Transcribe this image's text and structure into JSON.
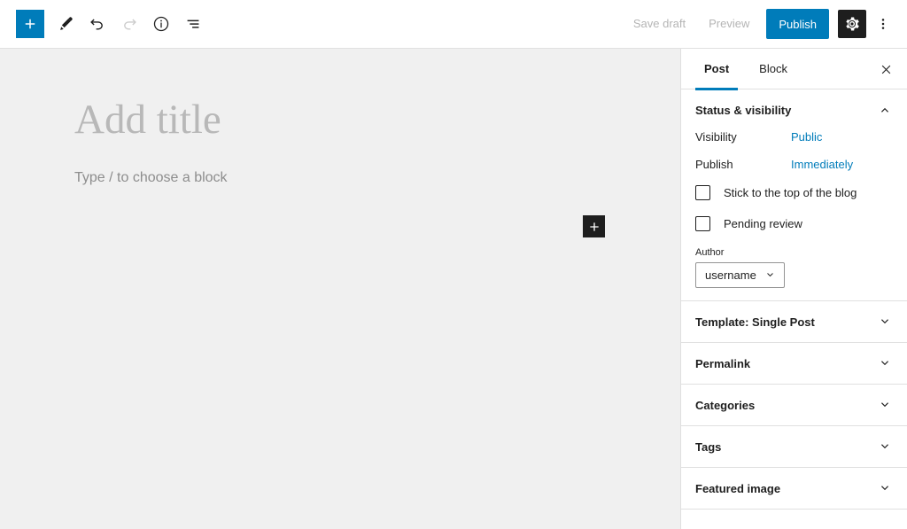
{
  "toolbar": {
    "inserter_label": "+",
    "icons": [
      {
        "name": "block-inserter-icon",
        "label": "Add block"
      },
      {
        "name": "pencil-icon",
        "label": "Tools"
      },
      {
        "name": "undo-icon",
        "label": "Undo"
      },
      {
        "name": "redo-icon",
        "label": "Redo"
      },
      {
        "name": "info-icon",
        "label": "Details"
      },
      {
        "name": "list-view-icon",
        "label": "List view"
      }
    ],
    "save_draft_label": "Save draft",
    "preview_label": "Preview",
    "publish_label": "Publish",
    "settings_label": "Settings",
    "more_options_label": "Options"
  },
  "canvas": {
    "title_placeholder": "Add title",
    "block_placeholder": "Type / to choose a block",
    "inserter_label": "+"
  },
  "sidebar": {
    "tabs": [
      {
        "label": "Post",
        "active": true
      },
      {
        "label": "Block",
        "active": false
      }
    ],
    "close_label": "Close settings",
    "status_panel": {
      "title": "Status & visibility",
      "visibility_label": "Visibility",
      "visibility_value": "Public",
      "publish_label": "Publish",
      "publish_value": "Immediately",
      "sticky_label": "Stick to the top of the blog",
      "pending_label": "Pending review",
      "author_label": "Author",
      "author_value": "username"
    },
    "panels": [
      {
        "title": "Template: Single Post"
      },
      {
        "title": "Permalink"
      },
      {
        "title": "Categories"
      },
      {
        "title": "Tags"
      },
      {
        "title": "Featured image"
      }
    ]
  },
  "colors": {
    "accent_blue": "#007cba",
    "dark": "#1e1e1e",
    "canvas_bg": "#f0f0f0",
    "border": "#e0e0e0",
    "disabled_text": "#b5b5b5"
  }
}
